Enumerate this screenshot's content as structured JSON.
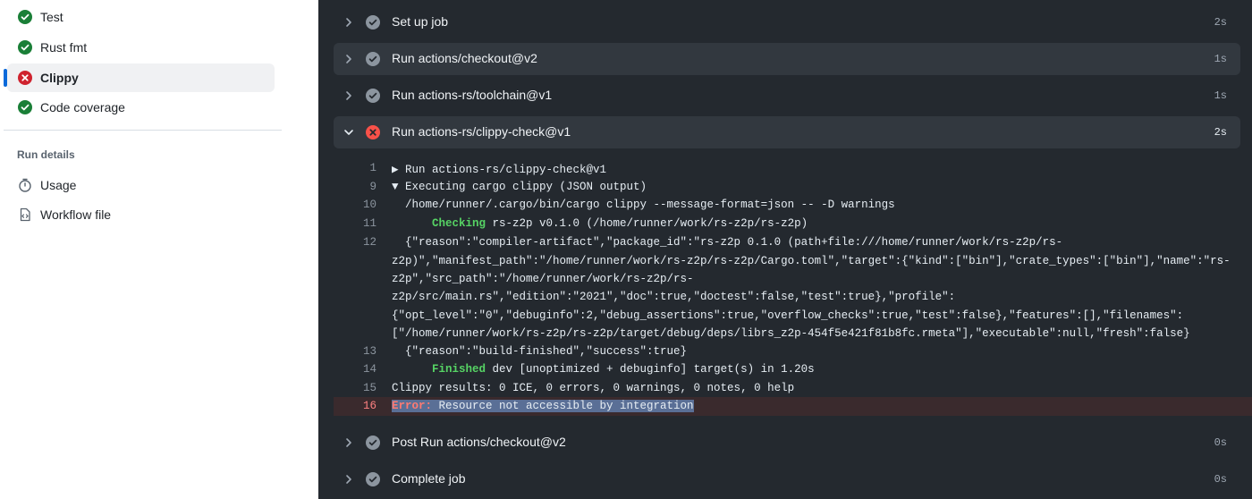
{
  "sidebar": {
    "jobs": [
      {
        "label": "Test",
        "status": "success"
      },
      {
        "label": "Rust fmt",
        "status": "success"
      },
      {
        "label": "Clippy",
        "status": "failure"
      },
      {
        "label": "Code coverage",
        "status": "success"
      }
    ],
    "run_details_title": "Run details",
    "details": [
      {
        "label": "Usage",
        "icon": "stopwatch-icon"
      },
      {
        "label": "Workflow file",
        "icon": "file-code-icon"
      }
    ]
  },
  "steps": [
    {
      "title": "Set up job",
      "duration": "2s",
      "status": "success"
    },
    {
      "title": "Run actions/checkout@v2",
      "duration": "1s",
      "status": "success"
    },
    {
      "title": "Run actions-rs/toolchain@v1",
      "duration": "1s",
      "status": "success"
    },
    {
      "title": "Run actions-rs/clippy-check@v1",
      "duration": "2s",
      "status": "failure",
      "expanded": true
    },
    {
      "title": "Post Run actions/checkout@v2",
      "duration": "0s",
      "status": "success"
    },
    {
      "title": "Complete job",
      "duration": "0s",
      "status": "success"
    }
  ],
  "log": {
    "l1": {
      "num": "1",
      "text": "▶ Run actions-rs/clippy-check@v1"
    },
    "l9": {
      "num": "9",
      "text": "▼ Executing cargo clippy (JSON output)"
    },
    "l10": {
      "num": "10",
      "text": "  /home/runner/.cargo/bin/cargo clippy --message-format=json -- -D warnings"
    },
    "l11": {
      "num": "11",
      "keyword": "      Checking",
      "text": " rs-z2p v0.1.0 (/home/runner/work/rs-z2p/rs-z2p)"
    },
    "l12": {
      "num": "12",
      "lines": [
        "  {\"reason\":\"compiler-artifact\",\"package_id\":\"rs-z2p 0.1.0 (path+file:///home/runner/work/rs-z2p/rs-",
        "z2p)\",\"manifest_path\":\"/home/runner/work/rs-z2p/rs-z2p/Cargo.toml\",\"target\":{\"kind\":[\"bin\"],\"crate_types\":[\"bin\"],\"name\":\"rs-",
        "z2p\",\"src_path\":\"/home/runner/work/rs-z2p/rs-",
        "z2p/src/main.rs\",\"edition\":\"2021\",\"doc\":true,\"doctest\":false,\"test\":true},\"profile\":",
        "{\"opt_level\":\"0\",\"debuginfo\":2,\"debug_assertions\":true,\"overflow_checks\":true,\"test\":false},\"features\":[],\"filenames\":",
        "[\"/home/runner/work/rs-z2p/rs-z2p/target/debug/deps/librs_z2p-454f5e421f81b8fc.rmeta\"],\"executable\":null,\"fresh\":false}"
      ]
    },
    "l13": {
      "num": "13",
      "text": "  {\"reason\":\"build-finished\",\"success\":true}"
    },
    "l14": {
      "num": "14",
      "keyword": "      Finished",
      "text": " dev [unoptimized + debuginfo] target(s) in 1.20s"
    },
    "l15": {
      "num": "15",
      "text": "Clippy results: 0 ICE, 0 errors, 0 warnings, 0 notes, 0 help"
    },
    "l16": {
      "num": "16",
      "keyword": "Error:",
      "text": " Resource not accessible by integration"
    }
  },
  "colors": {
    "success": "#1a7f37",
    "failure": "#cf222e",
    "step_check": "#8c959f",
    "step_fail": "#f85149"
  }
}
